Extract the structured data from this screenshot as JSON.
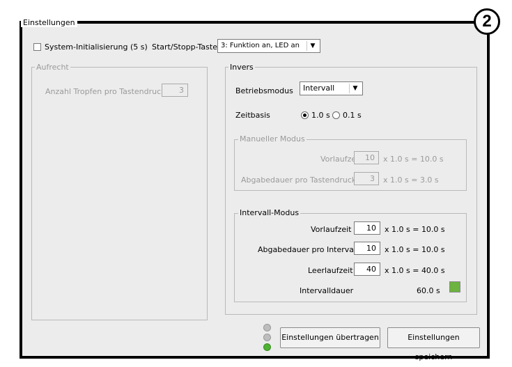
{
  "panel": {
    "title": "Einstellungen",
    "callout_number": "2"
  },
  "top_row": {
    "system_init_label": "System-Initialisierung (5 s)",
    "system_init_checked": false,
    "start_stop_label": "Start/Stopp-Taste",
    "start_stop_value": "3: Funktion an, LED an"
  },
  "aufrecht": {
    "title": "Aufrecht",
    "drops_label": "Anzahl Tropfen pro Tastendruck",
    "drops_value": "3"
  },
  "invers": {
    "title": "Invers",
    "mode_label": "Betriebsmodus",
    "mode_value": "Intervall",
    "timebase_label": "Zeitbasis",
    "timebase_option1": "1.0 s",
    "timebase_option2": "0.1 s",
    "timebase_selected": "1.0 s",
    "manual": {
      "title": "Manueller Modus",
      "pre_label": "Vorlaufzeit",
      "pre_value": "10",
      "pre_result": "x 1.0 s = 10.0 s",
      "dispense_label": "Abgabedauer pro Tastendruck",
      "dispense_value": "3",
      "dispense_result": "x 1.0 s = 3.0 s"
    },
    "interval": {
      "title": "Intervall-Modus",
      "pre_label": "Vorlaufzeit",
      "pre_value": "10",
      "pre_result": "x 1.0 s = 10.0 s",
      "dispense_label": "Abgabedauer pro Intervall",
      "dispense_value": "10",
      "dispense_result": "x 1.0 s = 10.0 s",
      "idle_label": "Leerlaufzeit",
      "idle_value": "40",
      "idle_result": "x 1.0 s = 40.0 s",
      "duration_label": "Intervalldauer",
      "duration_value": "60.0 s",
      "indicator_color": "#6cb33f"
    }
  },
  "buttons": {
    "transfer": "Einstellungen übertragen",
    "save": "Einstellungen speichern"
  },
  "status_leds": [
    "#bdbdbd",
    "#bdbdbd",
    "#4fb233"
  ]
}
